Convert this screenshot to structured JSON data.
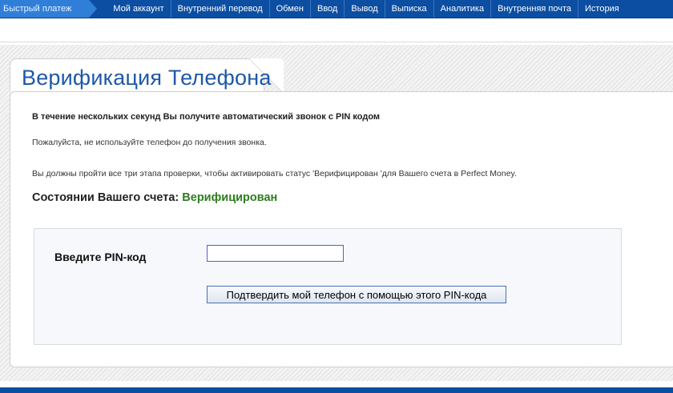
{
  "nav": {
    "quick": "Быстрый платеж",
    "items": [
      "Мой аккаунт",
      "Внутренний перевод",
      "Обмен",
      "Ввод",
      "Вывод",
      "Выписка",
      "Аналитика",
      "Внутренняя почта",
      "История"
    ]
  },
  "page": {
    "title": "Верификация Телефона",
    "call_notice": "В течение нескольких секунд Вы получите автоматический звонок с PIN кодом",
    "do_not_use": "Пожалуйста, не используйте телефон до получения звонка.",
    "three_steps": "Вы должны пройти все три этапа проверки, чтобы активировать статус 'Верифицирован 'для Вашего счета в Perfect Money.",
    "status_label": "Состоянии Вашего счета:",
    "status_value": "Верифицирован"
  },
  "pin_form": {
    "label": "Введите PIN-код",
    "value": "",
    "submit_label": "Подтвердить мой телефон с помощью этого PIN-кода"
  },
  "colors": {
    "nav_bg": "#0b4ea2",
    "title": "#1e58a8",
    "status_ok": "#2e7d1f"
  }
}
